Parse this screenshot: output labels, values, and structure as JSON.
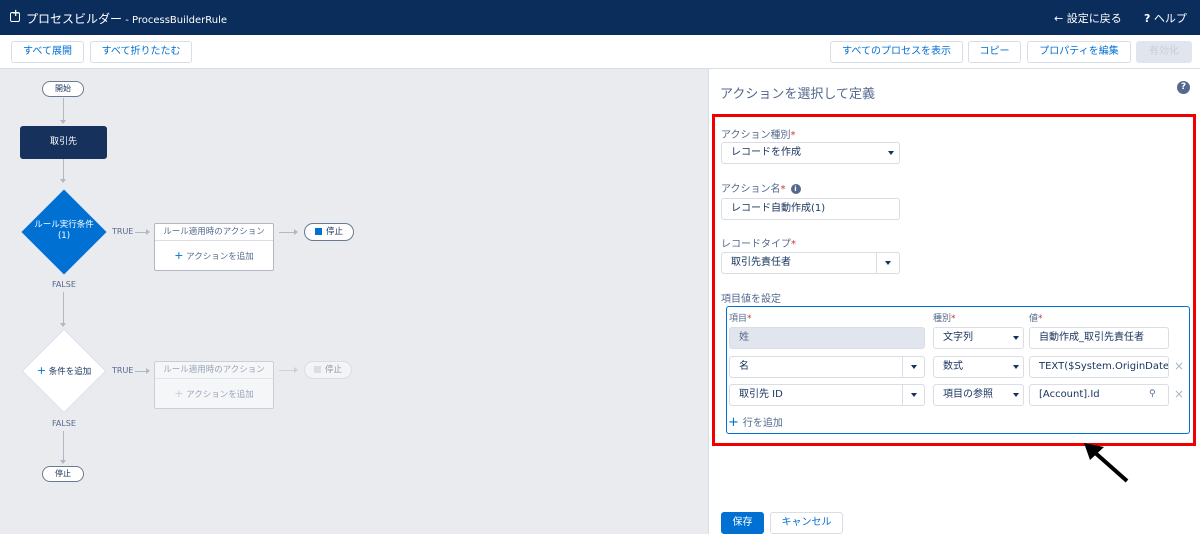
{
  "header": {
    "app_title": "プロセスビルダー",
    "process_name": " - ProcessBuilderRule",
    "back_label": "設定に戻る",
    "help_label": "ヘルプ"
  },
  "toolbar": {
    "expand_all": "すべて展開",
    "collapse_all": "すべて折りたたむ",
    "view_all_processes": "すべてのプロセスを表示",
    "copy": "コピー",
    "edit_properties": "プロパティを編集",
    "activate": "有効化"
  },
  "canvas": {
    "start_label": "開始",
    "object_node": "取引先",
    "criteria_1_line1": "ルール実行条件",
    "criteria_1_line2": "(1)",
    "true_label": "TRUE",
    "false_label": "FALSE",
    "immediate_actions_header": "ルール適用時のアクション",
    "add_action": "アクションを追加",
    "stop_label": "停止",
    "add_criteria": "条件を追加",
    "end_label": "停止"
  },
  "panel": {
    "title": "アクションを選択して定義",
    "action_type_label": "アクション種別",
    "action_type_value": "レコードを作成",
    "action_name_label": "アクション名",
    "action_name_value": "レコード自動作成(1)",
    "record_type_label": "レコードタイプ",
    "record_type_value": "取引先責任者",
    "set_fields_label": "項目値を設定",
    "col_field": "項目",
    "col_type": "種別",
    "col_value": "値",
    "rows": [
      {
        "field": "姓",
        "type": "文字列",
        "value": "自動作成_取引先責任者"
      },
      {
        "field": "名",
        "type": "数式",
        "value": "TEXT($System.OriginDate..."
      },
      {
        "field": "取引先 ID",
        "type": "項目の参照",
        "value": "[Account].Id"
      }
    ],
    "add_row": "行を追加",
    "save": "保存",
    "cancel": "キャンセル"
  },
  "colors": {
    "header_bg": "#0b2d5b",
    "accent": "#0070d2",
    "highlight_frame": "#e00000"
  }
}
